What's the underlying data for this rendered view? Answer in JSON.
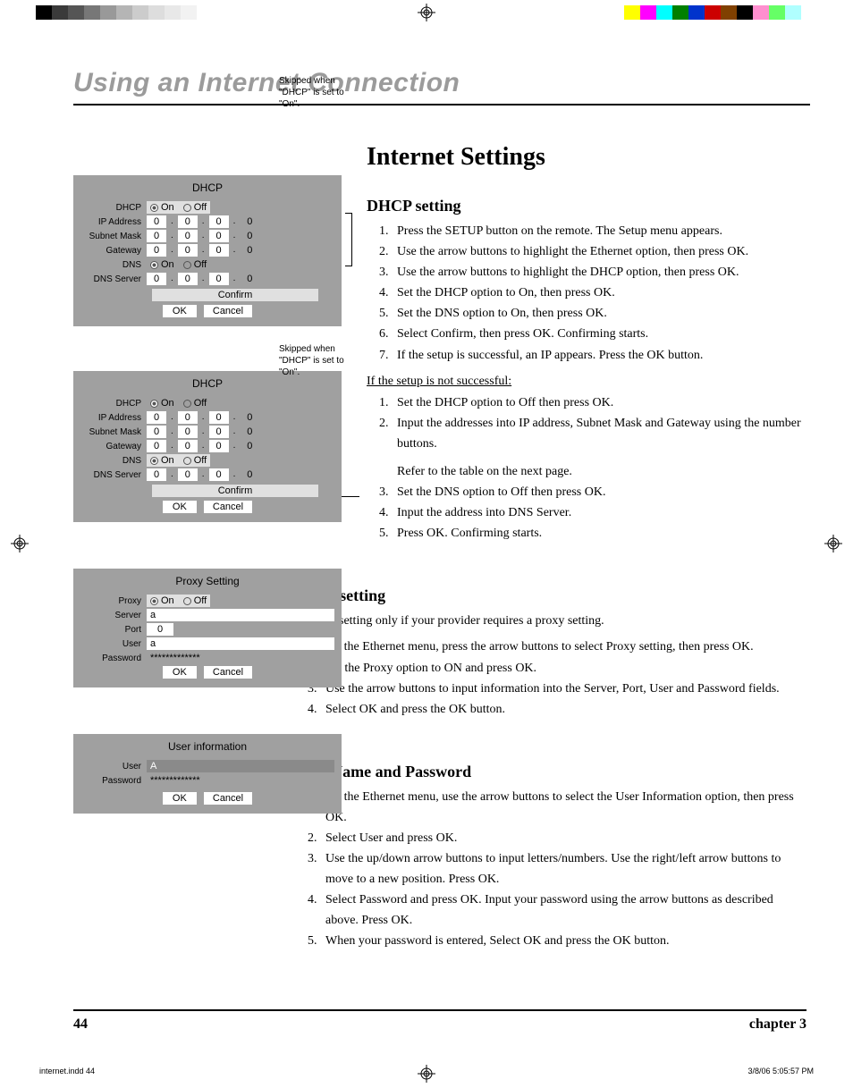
{
  "chapter_title": "Using an Internet Connection",
  "section_title": "Internet Settings",
  "dhcp": {
    "heading": "DHCP setting",
    "steps": [
      "Press the SETUP button on the remote. The Setup menu appears.",
      "Use the arrow buttons to highlight the Ethernet option, then press OK.",
      "Use the arrow buttons to highlight the DHCP option, then press OK.",
      "Set the DHCP option to On, then press OK.",
      "Set the DNS option to On, then press OK.",
      "Select Confirm, then press OK. Confirming starts.",
      "If the setup is successful, an IP appears. Press the OK button."
    ],
    "unsuccessful_label": "If the setup is not successful:",
    "unsuccessful_steps": [
      "Set the DHCP option to Off then press OK.",
      "Input the addresses into IP address, Subnet Mask and Gateway using the number buttons.",
      "Refer to the table on the next page.",
      "Set the DNS option to Off then press OK.",
      "Input the address into DNS Server.",
      "Press OK. Confirming starts."
    ]
  },
  "proxy": {
    "heading": "Proxy setting",
    "intro": "Use this setting only if your provider requires a proxy setting.",
    "steps": [
      "On the Ethernet menu, press the arrow buttons to select Proxy setting, then press OK.",
      "Set the Proxy option to ON and press OK.",
      "Use the arrow buttons to input information into the Server, Port, User and Password fields.",
      "Select OK and press the OK button."
    ]
  },
  "user": {
    "heading": "User Name and Password",
    "steps": [
      "On the Ethernet menu, use the arrow buttons to select the User Information option, then press OK.",
      "Select User and press OK.",
      "Use the up/down arrow buttons to input letters/numbers. Use the right/left arrow buttons to move to a new position. Press OK.",
      "Select Password and press OK. Input your password using the arrow buttons as described above. Press OK.",
      "When your password is entered, Select OK and press the OK button."
    ]
  },
  "panel": {
    "dhcp_title": "DHCP",
    "labels": {
      "dhcp": "DHCP",
      "ip": "IP Address",
      "subnet": "Subnet Mask",
      "gateway": "Gateway",
      "dns": "DNS",
      "dns_server": "DNS Server",
      "confirm": "Confirm",
      "ok": "OK",
      "cancel": "Cancel",
      "on": "On",
      "off": "Off"
    },
    "ip_octet": "0",
    "proxy_title": "Proxy Setting",
    "proxy": {
      "proxy": "Proxy",
      "server": "Server",
      "port": "Port",
      "user": "User",
      "password": "Password",
      "server_val": "a",
      "port_val": "0",
      "user_val": "a",
      "pw_val": "*************"
    },
    "userinfo_title": "User information",
    "userinfo": {
      "user": "User",
      "password": "Password",
      "user_val": "A",
      "pw_val": "*************"
    }
  },
  "callout": {
    "skipped_on": "Skipped when \"DHCP\" is set to \"On\"."
  },
  "footer": {
    "page": "44",
    "chapter": "chapter 3",
    "slug_left": "internet.indd   44",
    "slug_right": "3/8/06   5:05:57 PM"
  },
  "colorbar_left": [
    "#000",
    "#3a3a3a",
    "#555",
    "#777",
    "#999",
    "#b5b5b5",
    "#ccc",
    "#ddd",
    "#e8e8e8",
    "#f2f2f2",
    "#fff",
    "#fff"
  ],
  "colorbar_right": [
    "#ffff00",
    "#ff00ff",
    "#00ffff",
    "#008000",
    "#0033cc",
    "#cc0000",
    "#804000",
    "#000",
    "#ff8fcf",
    "#66ff66",
    "#b0ffff",
    "#fff"
  ]
}
